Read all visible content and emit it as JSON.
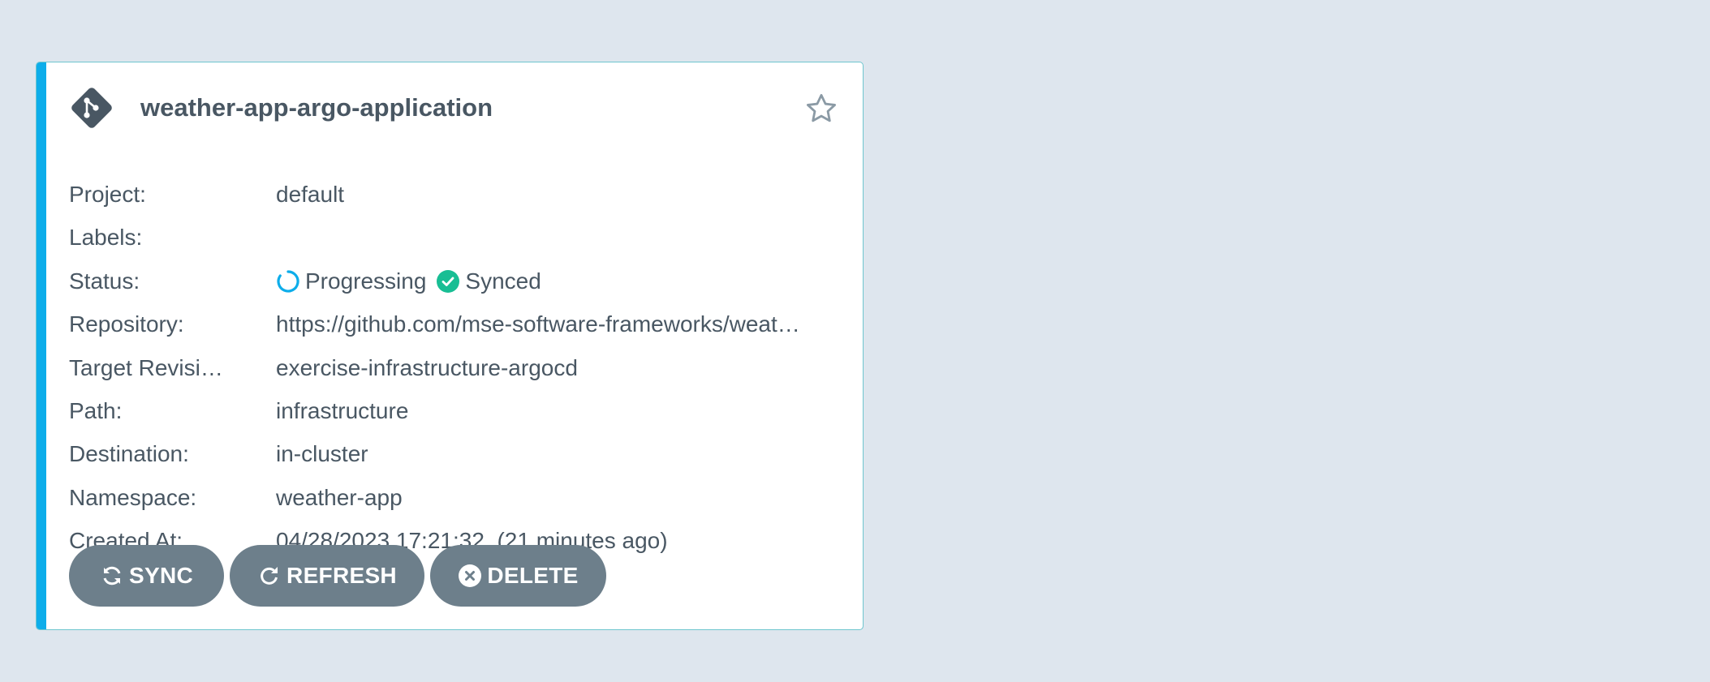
{
  "app": {
    "name": "weather-app-argo-application",
    "favorite_icon": "star-outline-icon",
    "type_icon": "git-icon"
  },
  "details": {
    "project": {
      "label": "Project:",
      "value": "default"
    },
    "labels": {
      "label": "Labels:",
      "value": ""
    },
    "status": {
      "label": "Status:",
      "health": "Progressing",
      "health_icon": "circle-notch-icon",
      "sync": "Synced",
      "sync_icon": "check-circle-icon"
    },
    "repository": {
      "label": "Repository:",
      "value": "https://github.com/mse-software-frameworks/weat…"
    },
    "target_revision": {
      "label": "Target Revisi…",
      "value": "exercise-infrastructure-argocd"
    },
    "path": {
      "label": "Path:",
      "value": "infrastructure"
    },
    "destination": {
      "label": "Destination:",
      "value": "in-cluster"
    },
    "namespace": {
      "label": "Namespace:",
      "value": "weather-app"
    },
    "created_at": {
      "label": "Created At:",
      "value": "04/28/2023 17:21:32  (21 minutes ago)"
    }
  },
  "actions": {
    "sync": "SYNC",
    "refresh": "REFRESH",
    "delete": "DELETE"
  },
  "colors": {
    "background": "#dee6ee",
    "card_accent": "#0dadea",
    "card_border": "#6fc6cf",
    "button": "#6d7f8b",
    "progressing": "#0dadea",
    "synced": "#18be94",
    "text": "#495763"
  }
}
